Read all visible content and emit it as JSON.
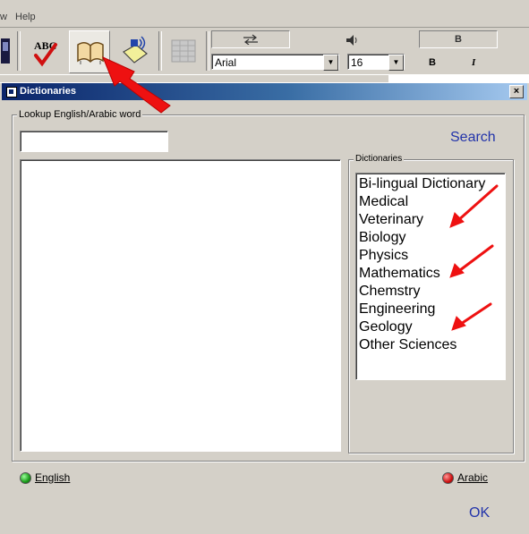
{
  "menu": {
    "items": [
      "w",
      "Help"
    ]
  },
  "toolbar": {
    "font_name": "Arial",
    "font_size": "16",
    "bold_label": "B",
    "italic_label": "I",
    "top_bold_label": "B"
  },
  "dialog": {
    "title": "Dictionaries",
    "close_label": "×",
    "lookup_group_label": "Lookup English/Arabic word",
    "lookup_value": "",
    "search_label": "Search",
    "dictionaries_group_label": "Dictionaries",
    "dictionaries": [
      "Bi-lingual Dictionary",
      "Medical",
      "Veterinary",
      "Biology",
      "Physics",
      "Mathematics",
      "Chemstry",
      "Engineering",
      "Geology",
      "Other Sciences"
    ],
    "english_label": "English",
    "arabic_label": "Arabic",
    "ok_label": "OK"
  },
  "colors": {
    "titlebar": "#0a246a",
    "link_blue": "#2233aa",
    "annotation_red": "#ee1111",
    "english_radio": "#22aa22",
    "arabic_radio": "#cc1111"
  },
  "icons": [
    "spell-check-icon",
    "dictionary-book-icon",
    "speak-icon",
    "grid-icon",
    "close-icon",
    "window-icon"
  ]
}
